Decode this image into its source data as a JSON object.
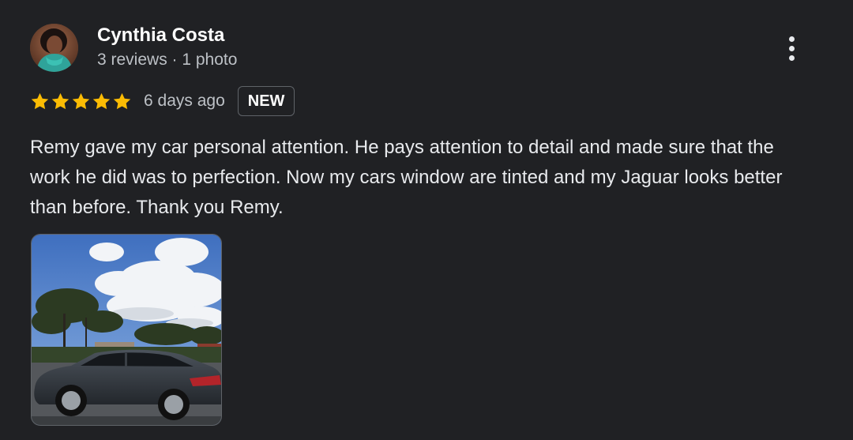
{
  "reviewer": {
    "name": "Cynthia Costa",
    "meta": "3 reviews · 1 photo",
    "avatar_icon": "profile-photo"
  },
  "rating": {
    "stars": 5,
    "max_stars": 5,
    "star_color": "#fbbc04",
    "date": "6 days ago",
    "badge": "NEW"
  },
  "review": {
    "text": "Remy gave my car personal attention. He pays attention to detail and made sure that the work he did was to perfection. Now my cars window are tinted and my Jaguar looks better than before. Thank you Remy."
  },
  "menu": {
    "icon": "more-vert-icon"
  },
  "photo": {
    "subject": "dark-car-photo"
  },
  "colors": {
    "background": "#202124",
    "primary_text": "#e8eaed",
    "secondary_text": "#bdc1c6",
    "border": "#5f6368"
  }
}
